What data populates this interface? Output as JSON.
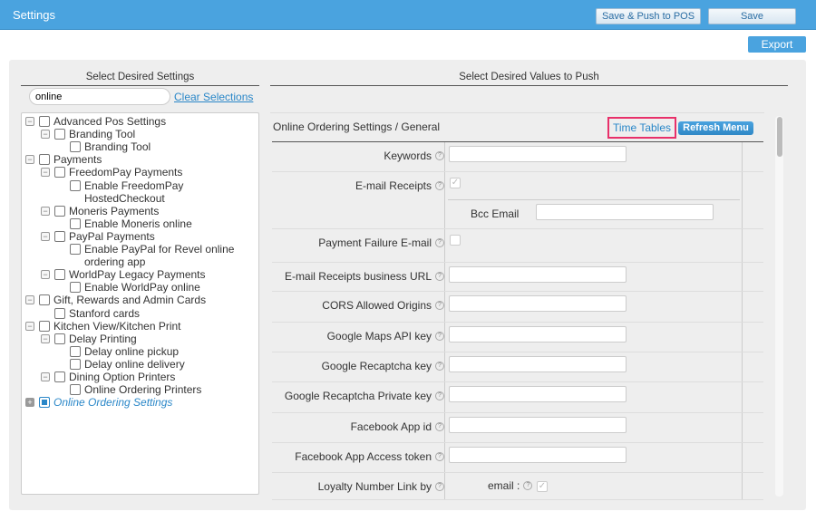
{
  "header": {
    "title": "Settings",
    "save_push": "Save & Push to POS",
    "save": "Save"
  },
  "export": "Export",
  "left": {
    "heading": "Select Desired Settings",
    "search_value": "online",
    "clear": "Clear Selections",
    "tree": [
      {
        "label": "Advanced Pos Settings",
        "level": 0,
        "toggle": "minus"
      },
      {
        "label": "Branding Tool",
        "level": 1,
        "toggle": "minus"
      },
      {
        "label": "Branding Tool",
        "level": 2
      },
      {
        "label": "Payments",
        "level": 0,
        "toggle": "minus"
      },
      {
        "label": "FreedomPay Payments",
        "level": 1,
        "toggle": "minus"
      },
      {
        "label": "Enable FreedomPay",
        "level": 2
      },
      {
        "label": "HostedCheckout",
        "level": 2,
        "cont": true
      },
      {
        "label": "Moneris Payments",
        "level": 1,
        "toggle": "minus"
      },
      {
        "label": "Enable Moneris online",
        "level": 2
      },
      {
        "label": "PayPal Payments",
        "level": 1,
        "toggle": "minus"
      },
      {
        "label": "Enable PayPal for Revel online",
        "level": 2
      },
      {
        "label": "ordering app",
        "level": 2,
        "cont": true
      },
      {
        "label": "WorldPay Legacy Payments",
        "level": 1,
        "toggle": "minus"
      },
      {
        "label": "Enable WorldPay online",
        "level": 2
      },
      {
        "label": "Gift, Rewards and Admin Cards",
        "level": 0,
        "toggle": "minus"
      },
      {
        "label": "Stanford cards",
        "level": 1
      },
      {
        "label": "Kitchen View/Kitchen Print",
        "level": 0,
        "toggle": "minus"
      },
      {
        "label": "Delay Printing",
        "level": 1,
        "toggle": "minus"
      },
      {
        "label": "Delay online pickup",
        "level": 2
      },
      {
        "label": "Delay online delivery",
        "level": 2
      },
      {
        "label": "Dining Option Printers",
        "level": 1,
        "toggle": "minus"
      },
      {
        "label": "Online Ordering Printers",
        "level": 2
      },
      {
        "label": "Online Ordering Settings",
        "level": 0,
        "toggle": "plus",
        "selected": true
      }
    ]
  },
  "right": {
    "heading": "Select Desired Values to Push",
    "section": "Online Ordering Settings / General",
    "time_tables": "Time Tables",
    "refresh_menu": "Refresh Menu",
    "rows": [
      {
        "label": "Keywords",
        "type": "input"
      },
      {
        "label": "E-mail Receipts",
        "type": "checkbox",
        "checked": true,
        "sub_label": "Bcc Email"
      },
      {
        "label": "Payment Failure E-mail",
        "type": "checkbox",
        "checked": false
      },
      {
        "label": "E-mail Receipts business URL",
        "type": "input"
      },
      {
        "label": "CORS Allowed Origins",
        "type": "input"
      },
      {
        "label": "Google Maps API key",
        "type": "input"
      },
      {
        "label": "Google Recaptcha key",
        "type": "input"
      },
      {
        "label": "Google Recaptcha Private key",
        "type": "input"
      },
      {
        "label": "Facebook App id",
        "type": "input"
      },
      {
        "label": "Facebook App Access token",
        "type": "input"
      },
      {
        "label": "Loyalty Number Link by",
        "type": "sub",
        "sub_label": "email :",
        "checked": true
      }
    ]
  }
}
